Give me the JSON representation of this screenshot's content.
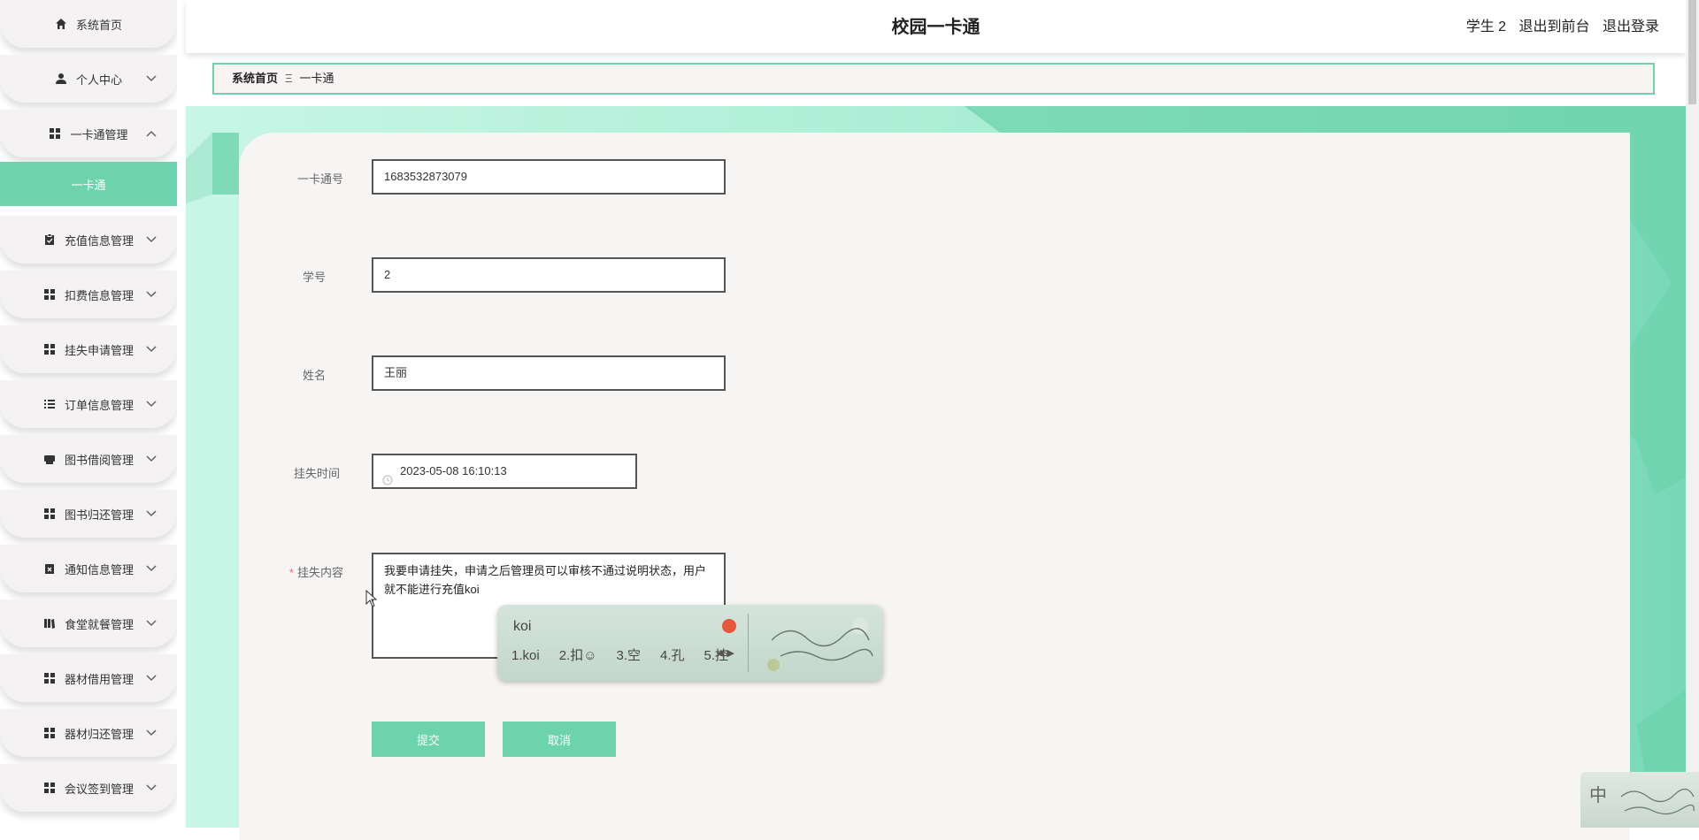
{
  "app": {
    "title": "校园一卡通"
  },
  "header": {
    "user": "学生 2",
    "to_front": "退出到前台",
    "logout": "退出登录"
  },
  "sidebar": {
    "items": [
      {
        "label": "系统首页",
        "icon": "home-icon"
      },
      {
        "label": "个人中心",
        "icon": "user-icon"
      },
      {
        "label": "一卡通管理",
        "icon": "grid-icon"
      },
      {
        "label": "充值信息管理",
        "icon": "clipboard-icon"
      },
      {
        "label": "扣费信息管理",
        "icon": "grid-icon"
      },
      {
        "label": "挂失申请管理",
        "icon": "grid-icon"
      },
      {
        "label": "订单信息管理",
        "icon": "list-icon"
      },
      {
        "label": "图书借阅管理",
        "icon": "printer-icon"
      },
      {
        "label": "图书归还管理",
        "icon": "grid-icon"
      },
      {
        "label": "通知信息管理",
        "icon": "clipboard-x-icon"
      },
      {
        "label": "食堂就餐管理",
        "icon": "book-icon"
      },
      {
        "label": "器材借用管理",
        "icon": "grid-icon"
      },
      {
        "label": "器材归还管理",
        "icon": "grid-icon"
      },
      {
        "label": "会议签到管理",
        "icon": "grid-icon"
      }
    ],
    "active_sub": "一卡通"
  },
  "breadcrumb": {
    "home": "系统首页",
    "sep": "Ξ",
    "current": "一卡通"
  },
  "form": {
    "card_no_label": "一卡通号",
    "card_no": "1683532873079",
    "student_no_label": "学号",
    "student_no": "2",
    "name_label": "姓名",
    "name": "王丽",
    "time_label": "挂失时间",
    "time": "2023-05-08 16:10:13",
    "content_label": "挂失内容",
    "required_mark": "*",
    "content": "我要申请挂失，申请之后管理员可以审核不通过说明状态，用户就不能进行充值koi",
    "submit": "提交",
    "cancel": "取消"
  },
  "ime": {
    "composition": "koi",
    "candidates": [
      "1.koi",
      "2.扣☺",
      "3.空",
      "4.孔",
      "5.控"
    ],
    "tray_mode": "中"
  },
  "colors": {
    "accent": "#6dd3ae",
    "bg": "#f7f4f4"
  }
}
